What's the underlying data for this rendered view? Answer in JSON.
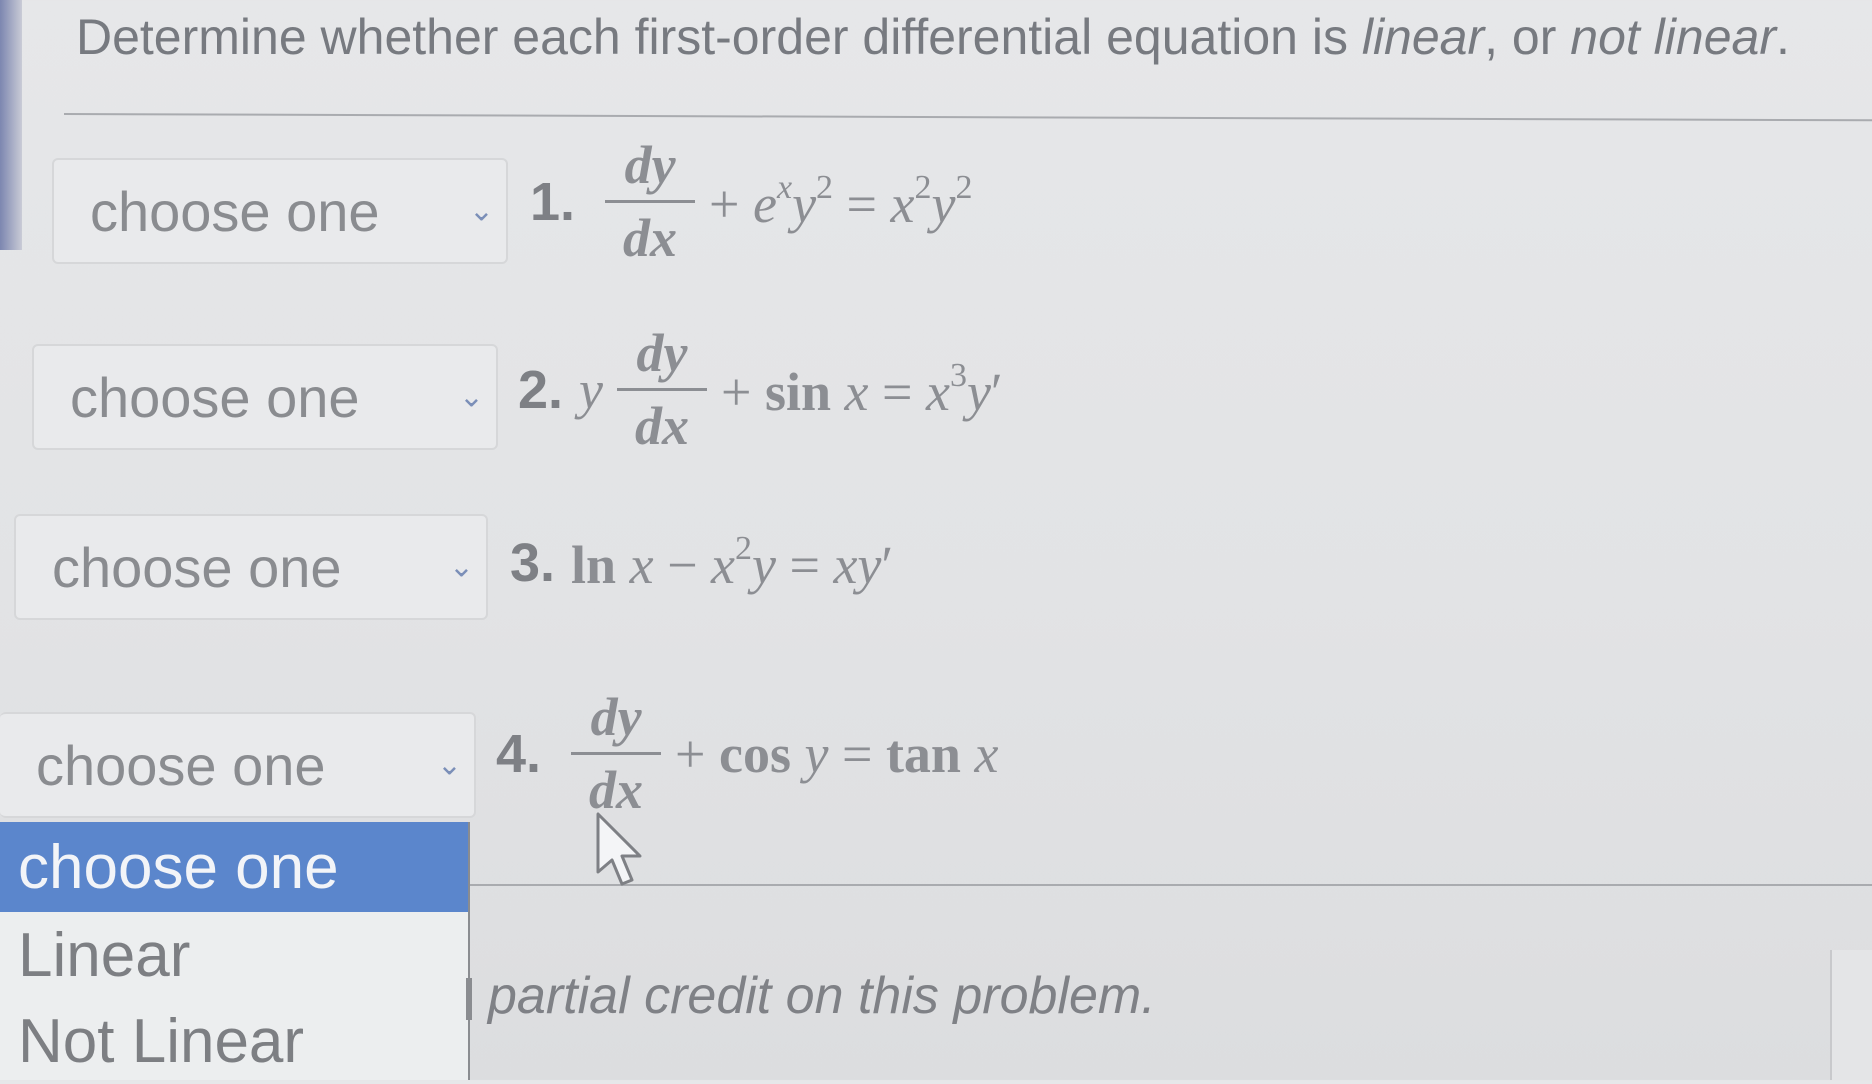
{
  "instruction": {
    "prefix": "Determine whether each first-order differential equation is ",
    "linear_word": "linear",
    "middle": ", or ",
    "not_linear_word": "not linear",
    "suffix": "."
  },
  "questions": [
    {
      "select_value": "choose one",
      "number": "1."
    },
    {
      "select_value": "choose one",
      "number": "2."
    },
    {
      "select_value": "choose one",
      "number": "3."
    },
    {
      "select_value": "choose one",
      "number": "4."
    }
  ],
  "dropdown": {
    "options": [
      "choose one",
      "Linear",
      "Not Linear"
    ],
    "selected_index": 0
  },
  "credit_text": "partial credit on this problem.",
  "colors": {
    "selected_option_bg": "#5b86cc",
    "chevron": "#7b8fb8"
  }
}
